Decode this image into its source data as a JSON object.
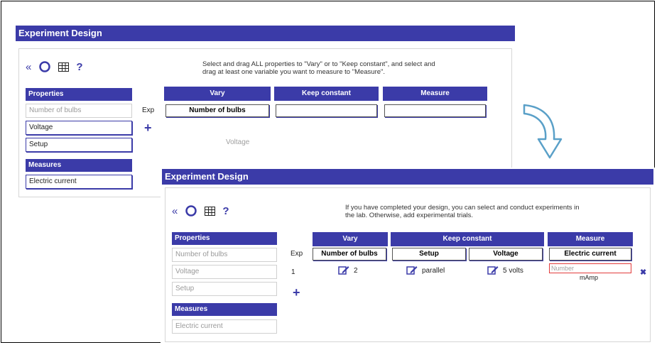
{
  "panel1": {
    "title": "Experiment Design",
    "instructions_line1": "Select and drag ALL properties to \"Vary\" or to \"Keep constant\", and select and",
    "instructions_line2": "drag at least one variable you want to measure to \"Measure\".",
    "properties_header": "Properties",
    "properties": [
      "Number of bulbs",
      "Voltage",
      "Setup"
    ],
    "measures_header": "Measures",
    "measures": [
      "Electric current"
    ],
    "exp_label": "Exp",
    "columns": [
      "Vary",
      "Keep constant",
      "Measure"
    ],
    "vary_values": [
      "Number of bulbs"
    ],
    "drag_ghost": "Voltage"
  },
  "panel2": {
    "title": "Experiment Design",
    "instructions_line1": "If you have completed your design, you can select and conduct experiments in",
    "instructions_line2": "the lab. Otherwise, add experimental trials.",
    "properties_header": "Properties",
    "properties": [
      "Number of bulbs",
      "Voltage",
      "Setup"
    ],
    "measures_header": "Measures",
    "measures": [
      "Electric current"
    ],
    "exp_label": "Exp",
    "columns": [
      "Vary",
      "Keep constant",
      "Measure"
    ],
    "fields": [
      "Number of bulbs",
      "Setup",
      "Voltage",
      "Electric current"
    ],
    "trial": {
      "number": "1",
      "bulbs": "2",
      "setup": "parallel",
      "voltage": "5 volts",
      "measure_placeholder": "Number",
      "measure_unit": "mAmp"
    }
  },
  "toolbar": {
    "back_glyph": "«",
    "help_glyph": "?"
  },
  "colors": {
    "accent": "#3b3ba8",
    "error": "#e23b3b"
  }
}
